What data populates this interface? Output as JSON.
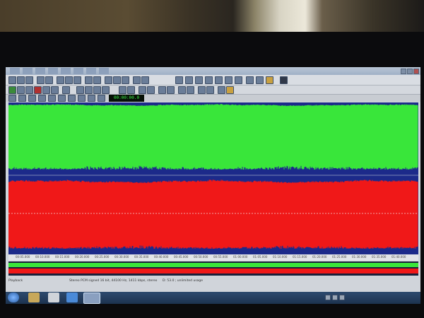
{
  "screen": {
    "app": "audio-editor",
    "time_display": "00:00:00.0",
    "ruler_ticks": [
      "00:05.000",
      "00:10.000",
      "00:15.000",
      "00:20.000",
      "00:25.000",
      "00:30.000",
      "00:35.000",
      "00:40.000",
      "00:45.000",
      "00:50.000",
      "00:55.000",
      "01:00.000",
      "01:05.000",
      "01:10.000",
      "01:15.000",
      "01:20.000",
      "01:25.000",
      "01:30.000",
      "01:35.000",
      "01:40.000"
    ],
    "status": {
      "left": "Playback",
      "middle": "Stereo PCM signed 16 bit, 44100 Hz, 1411 kbps, stereo",
      "right": "D: 53.0 ; unlimited usage"
    },
    "taskbar_icons": [
      "start-orb-icon",
      "folder-icon",
      "media-icon",
      "ie-icon",
      "audio-app-icon"
    ]
  },
  "colors": {
    "left_channel": "#39e63a",
    "right_channel": "#f01818",
    "background": "#1c2a8a"
  }
}
